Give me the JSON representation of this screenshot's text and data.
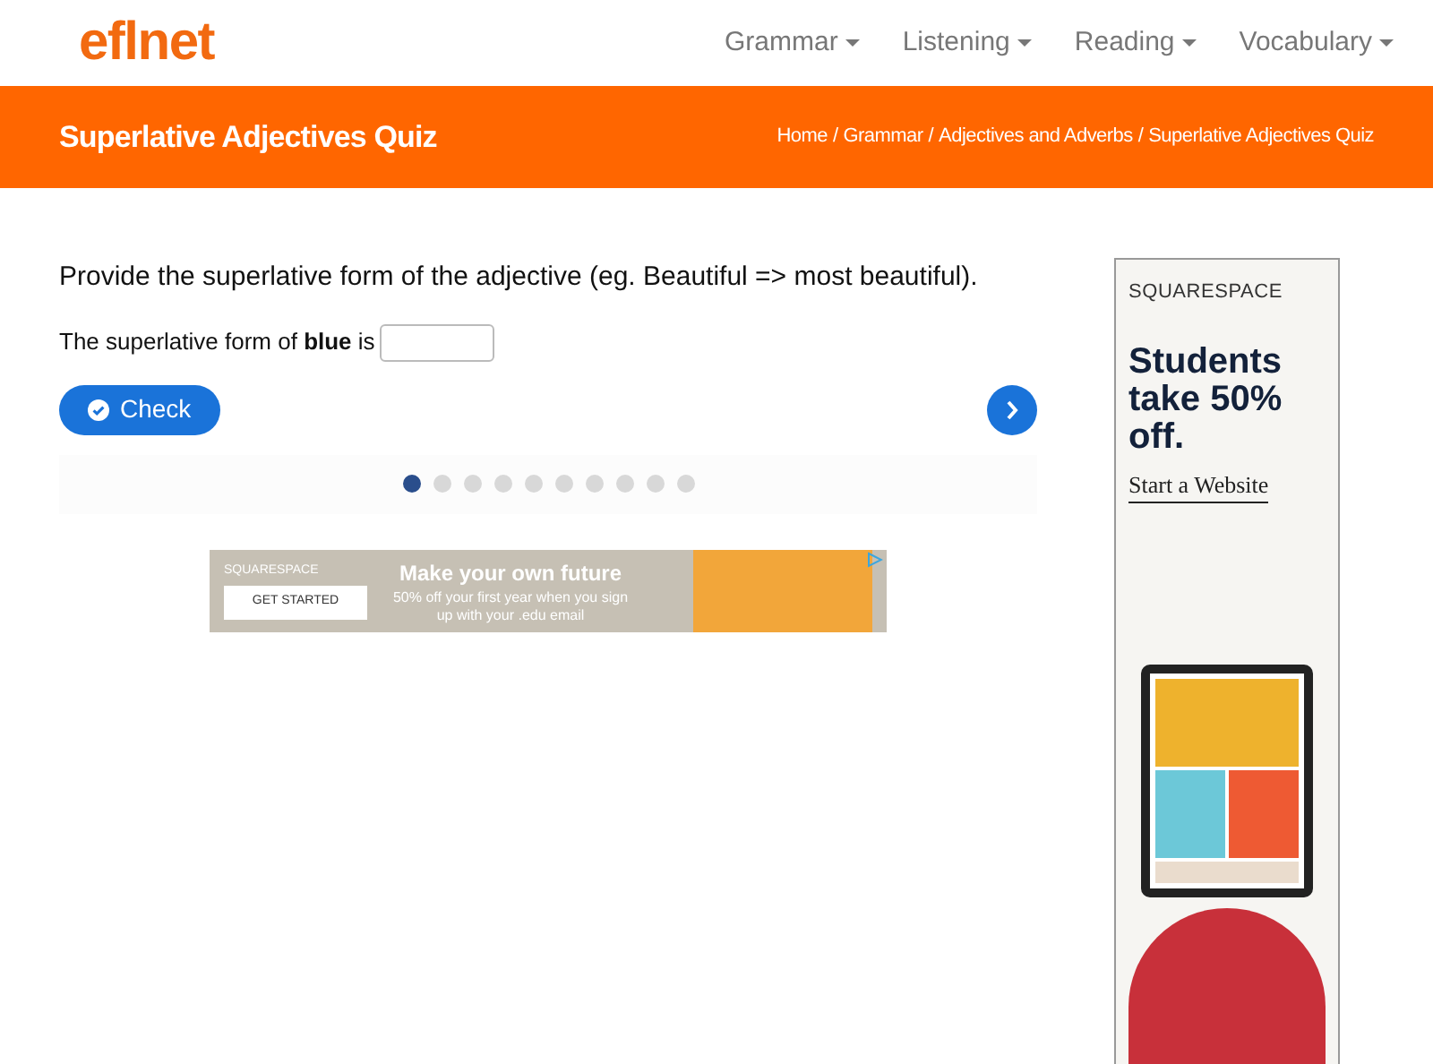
{
  "logo": {
    "text": "eflnet"
  },
  "nav": [
    {
      "label": "Grammar"
    },
    {
      "label": "Listening"
    },
    {
      "label": "Reading"
    },
    {
      "label": "Vocabulary"
    }
  ],
  "banner": {
    "title": "Superlative Adjectives Quiz",
    "separator": "/",
    "breadcrumb": [
      "Home",
      "Grammar",
      "Adjectives and Adverbs",
      "Superlative Adjectives Quiz"
    ]
  },
  "quiz": {
    "instruction": "Provide the superlative form of the adjective (eg. Beautiful => most beautiful).",
    "question": "The superlative form of **blue** is",
    "check_label": "Check",
    "dots": [
      {
        "selected": true
      },
      {
        "selected": false
      },
      {
        "selected": false
      },
      {
        "selected": false
      },
      {
        "selected": false
      },
      {
        "selected": false
      },
      {
        "selected": false
      },
      {
        "selected": false
      },
      {
        "selected": false
      },
      {
        "selected": false
      }
    ]
  },
  "ad_banner": {
    "brand": "SQUARESPACE",
    "cta": "GET STARTED",
    "headline": "Make your own future",
    "body": "50% off your first year when you sign up with your .edu email"
  },
  "ad_side": {
    "brand": "SQUARESPACE",
    "headline": "Students take 50% off.",
    "cta": "Start a Website"
  }
}
